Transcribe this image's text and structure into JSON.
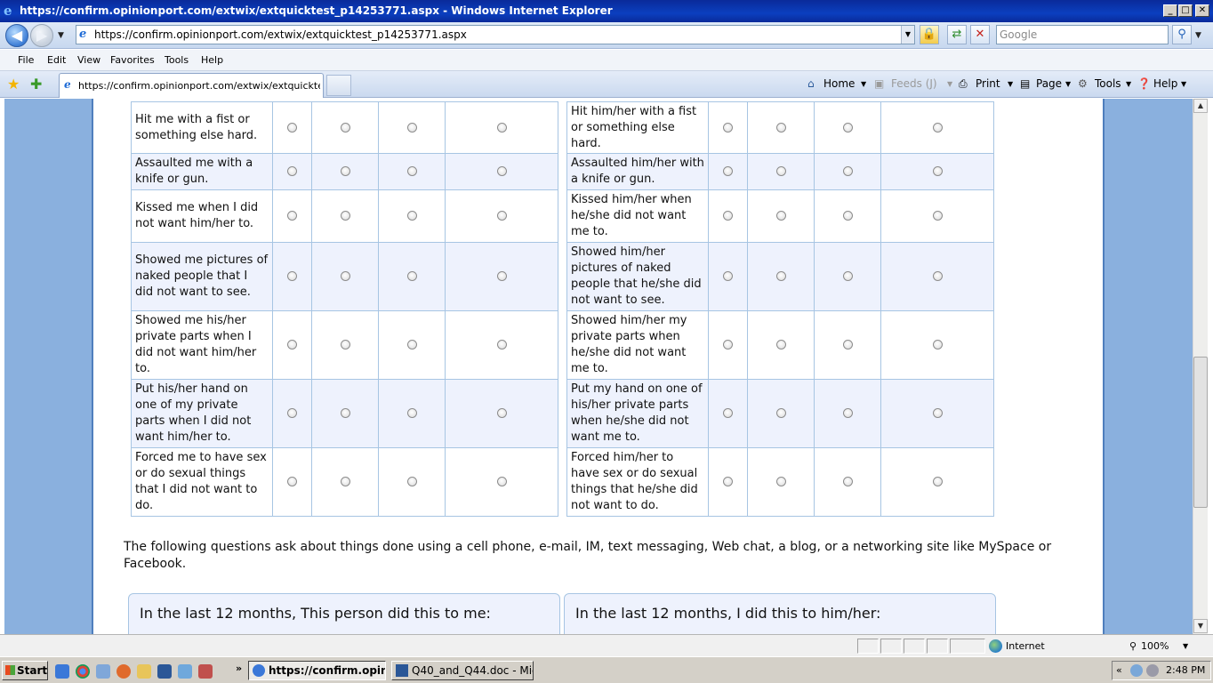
{
  "window": {
    "title": "https://confirm.opinionport.com/extwix/extquicktest_p14253771.aspx - Windows Internet Explorer",
    "min": "_",
    "max": "□",
    "close": "✕"
  },
  "address": {
    "url": "https://confirm.opinionport.com/extwix/extquicktest_p14253771.aspx",
    "search_placeholder": "Google"
  },
  "menu": [
    "File",
    "Edit",
    "View",
    "Favorites",
    "Tools",
    "Help"
  ],
  "tab": {
    "title": "https://confirm.opinionport.com/extwix/extquicktest_..."
  },
  "command_bar": {
    "home": "Home",
    "feeds": "Feeds (J)",
    "print": "Print",
    "page": "Page",
    "tools": "Tools",
    "help": "Help"
  },
  "survey": {
    "left_rows": [
      "Hit me with a fist or something else hard.",
      "Assaulted me with a knife or gun.",
      "Kissed me when I did not want him/her to.",
      "Showed me pictures of naked people that I did not want to see.",
      "Showed me his/her private parts when I did not want him/her to.",
      "Put his/her hand on one of my private parts when I did not want him/her to.",
      "Forced me to have sex or do sexual things that I did not want to do."
    ],
    "right_rows": [
      "Hit him/her with a fist or something else hard.",
      "Assaulted him/her with a knife or gun.",
      "Kissed him/her when he/she did not want me to.",
      "Showed him/her pictures of naked people that he/she did not want to see.",
      "Showed him/her my private parts when he/she did not want me to.",
      "Put my hand on one of his/her private parts when he/she did not want me to.",
      "Forced him/her to have sex or do sexual things that he/she did not want to do."
    ],
    "intro_text": "The following questions ask about things done using a cell phone, e-mail, IM, text messaging, Web chat, a blog, or a networking site like MySpace or Facebook.",
    "panel_left_heading": "In the last 12 months, This person did this to me:",
    "panel_right_heading": "In the last 12 months, I did this to him/her:"
  },
  "status": {
    "zone": "Internet",
    "zoom": "100%"
  },
  "taskbar": {
    "start": "Start",
    "buttons": [
      "https://confirm.opini...",
      "Q40_and_Q44.doc - Micr..."
    ],
    "clock": "2:48 PM"
  },
  "colors": {
    "accent_blue": "#8ab0de",
    "row_alt": "#eef2fd",
    "cell_border": "#a7c5e3"
  }
}
